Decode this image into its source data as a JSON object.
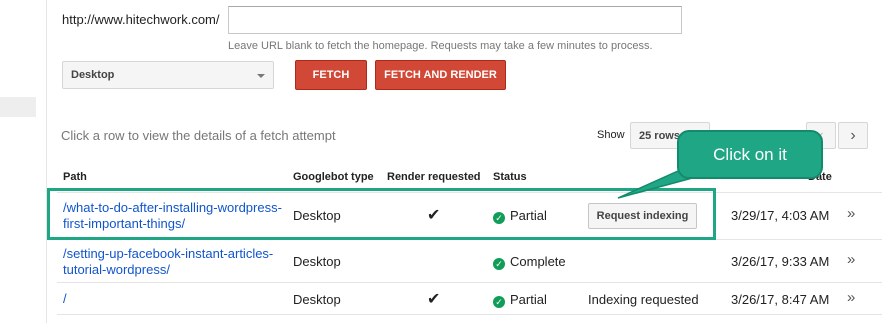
{
  "form": {
    "url_prefix": "http://www.hitechwork.com/",
    "url_value": "",
    "hint": "Leave URL blank to fetch the homepage. Requests may take a few minutes to process.",
    "device": "Desktop",
    "fetch_label": "FETCH",
    "fetch_render_label": "FETCH AND RENDER"
  },
  "table_controls": {
    "instruction": "Click a row to view the details of a fetch attempt",
    "show_label": "Show",
    "rows_value": "25 rows",
    "prev_icon": "chevron-left-icon",
    "next_icon": "chevron-right-icon"
  },
  "table": {
    "headers": {
      "path": "Path",
      "googlebot_type": "Googlebot type",
      "render_requested": "Render requested",
      "status": "Status",
      "date": "Date"
    },
    "rows": [
      {
        "path": "/what-to-do-after-installing-wordpress-first-important-things/",
        "googlebot_type": "Desktop",
        "render_requested": "✔",
        "status": "Partial",
        "action": "Request indexing",
        "date": "3/29/17, 4:03 AM"
      },
      {
        "path": "/setting-up-facebook-instant-articles-tutorial-wordpress/",
        "googlebot_type": "Desktop",
        "render_requested": "",
        "status": "Complete",
        "action": "",
        "date": "3/26/17, 9:33 AM"
      },
      {
        "path": "/",
        "googlebot_type": "Desktop",
        "render_requested": "✔",
        "status": "Partial",
        "action": "Indexing requested",
        "date": "3/26/17, 8:47 AM"
      }
    ]
  },
  "annotation": {
    "callout_text": "Click on it",
    "color": "#1fa785"
  },
  "colors": {
    "primary_button": "#d14836",
    "link": "#1155cc",
    "status_ok": "#0f9d58"
  }
}
